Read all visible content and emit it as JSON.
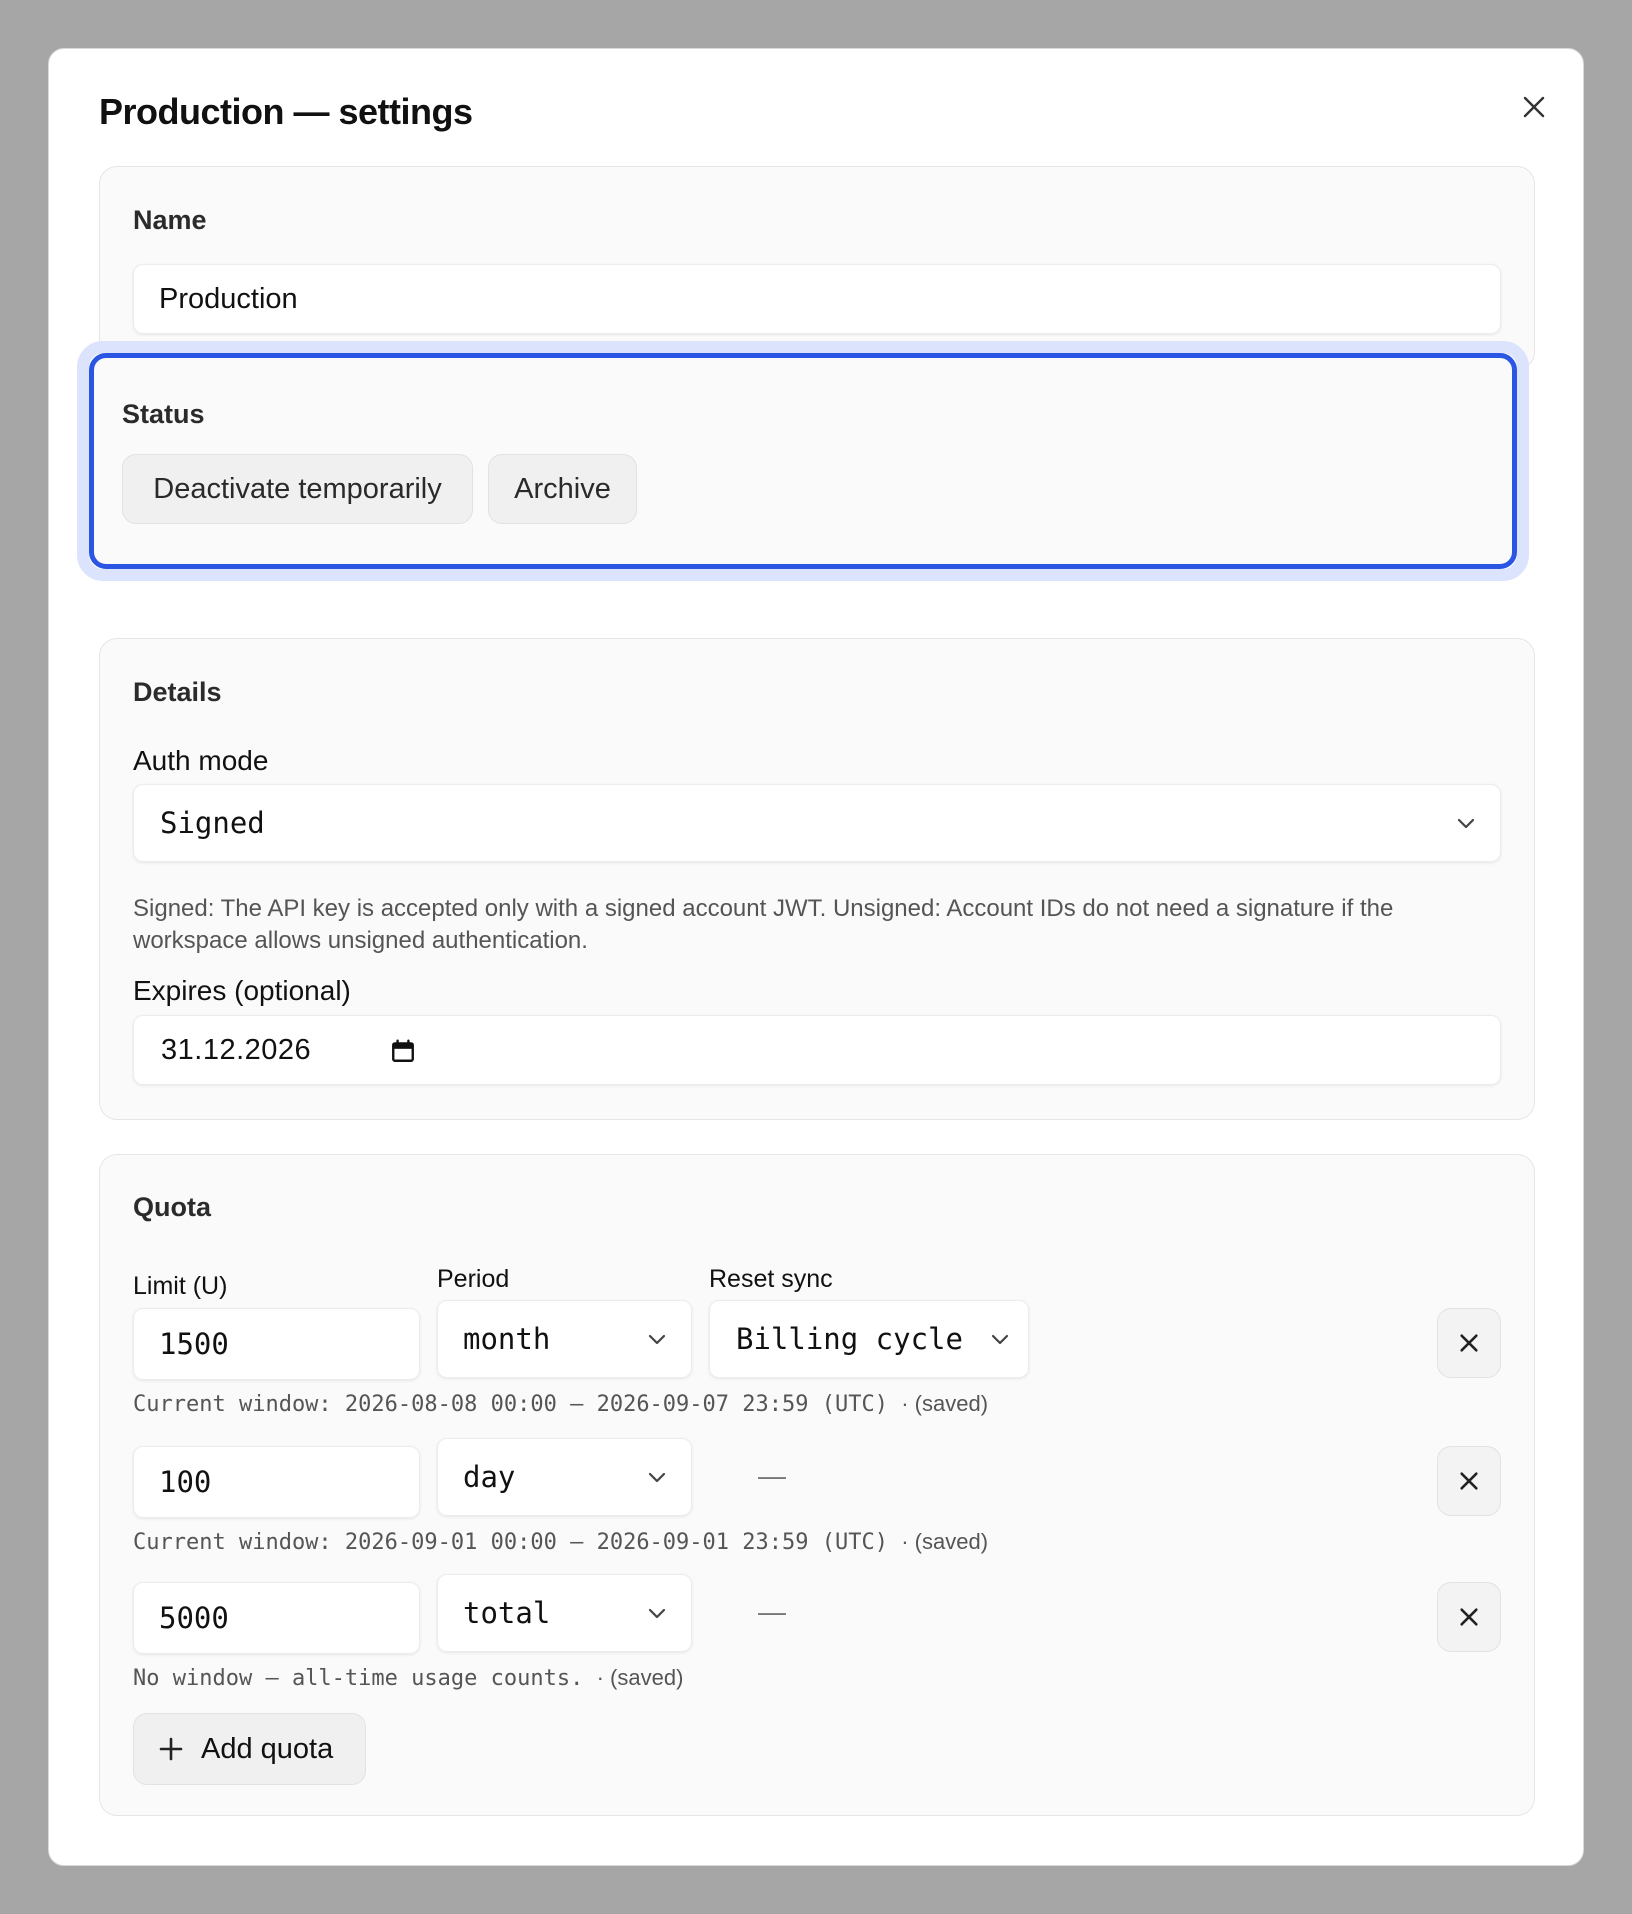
{
  "dialog": {
    "title": "Production — settings",
    "close_icon": "close-icon"
  },
  "name_section": {
    "title": "Name",
    "value": "Production"
  },
  "status_section": {
    "title": "Status",
    "buttons": [
      "Deactivate temporarily",
      "Archive"
    ],
    "focus_color": "#2a56e3"
  },
  "details_section": {
    "title": "Details",
    "auth_mode": {
      "label": "Auth mode",
      "value": "Signed",
      "help": "Signed: The API key is accepted only with a signed account JWT. Unsigned: Account IDs do not need a signature if the workspace allows unsigned authentication."
    },
    "expires": {
      "label": "Expires (optional)",
      "value": "31.12.2026",
      "icon": "calendar-icon"
    }
  },
  "quota_section": {
    "title": "Quota",
    "headers": {
      "limit": "Limit (U)",
      "period": "Period",
      "reset_sync": "Reset sync"
    },
    "rows": [
      {
        "limit": "1500",
        "period": "month",
        "reset_sync": "Billing cycle",
        "note": "Current window: 2026-08-08 00:00 – 2026-09-07 23:59 (UTC)",
        "saved": "· (saved)"
      },
      {
        "limit": "100",
        "period": "day",
        "reset_sync": "—",
        "note": "Current window: 2026-09-01 00:00 – 2026-09-01 23:59 (UTC)",
        "saved": "· (saved)"
      },
      {
        "limit": "5000",
        "period": "total",
        "reset_sync": "—",
        "note": "No window — all-time usage counts.",
        "saved": "· (saved)"
      }
    ],
    "add_button": "Add quota",
    "add_icon": "plus-icon",
    "remove_icon": "close-icon"
  }
}
